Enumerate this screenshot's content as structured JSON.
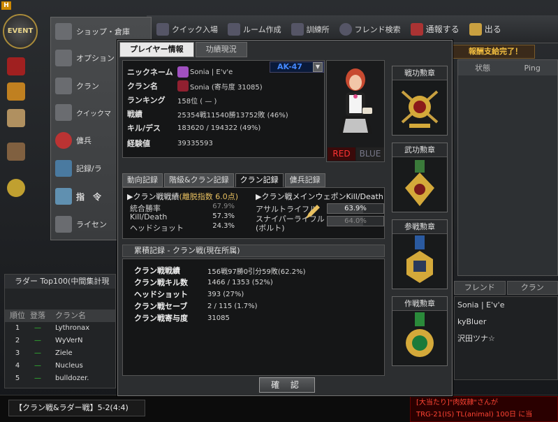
{
  "app": {
    "logo_letter": "H",
    "event_label": "EVENT"
  },
  "toolbar": {
    "items": [
      {
        "label": "クイック入場",
        "icon": "soldiers-icon"
      },
      {
        "label": "ルーム作成",
        "icon": "puzzle-icon"
      },
      {
        "label": "訓練所",
        "icon": "target-icon"
      },
      {
        "label": "フレンド検索",
        "icon": "search-icon"
      },
      {
        "label": "通報する",
        "icon": "alarm-icon"
      },
      {
        "label": "出る",
        "icon": "exit-icon"
      }
    ]
  },
  "left_menu": {
    "items": [
      {
        "label": "ショップ・倉庫"
      },
      {
        "label": "オプション"
      },
      {
        "label": "クラン"
      },
      {
        "label": "クイックマ"
      },
      {
        "label": "傭兵"
      },
      {
        "label": "記録/ラ"
      },
      {
        "label": "指　令"
      },
      {
        "label": "ライセン"
      }
    ]
  },
  "right_panel": {
    "headers": [
      "状態",
      "Ping"
    ],
    "tabs": [
      "フレンド",
      "クラン"
    ],
    "list": [
      "Sonia | E'v'e",
      "kyBluer",
      "沢田ツナ☆"
    ]
  },
  "notice_label": "報酬支給完了！",
  "ladder": {
    "title": "ラダー Top100(中間集計現",
    "headers": [
      "順位",
      "登落",
      "クラン名"
    ],
    "rows": [
      {
        "rank": "1",
        "move": "—",
        "name": "Lythronax"
      },
      {
        "rank": "2",
        "move": "—",
        "name": "WyVerN"
      },
      {
        "rank": "3",
        "move": "—",
        "name": "Ziele"
      },
      {
        "rank": "4",
        "move": "—",
        "name": "Nucleus"
      },
      {
        "rank": "5",
        "move": "—",
        "name": "bulldozer."
      }
    ]
  },
  "bottom": {
    "channel": "【クラン戦&ラダー戦】5-2(4:4)",
    "ticker": [
      "[大当たり]\"肉奴隷\"さんが",
      "TRG-21(IS) TL(animal) 100日 に当"
    ]
  },
  "modal": {
    "tabs": [
      "プレイヤー情報",
      "功績現況"
    ],
    "profile": {
      "nickname_label": "ニックネーム",
      "nickname": "Sonia | E'v'e",
      "clan_label": "クラン名",
      "clan": "Sonia (寄与度 31085)",
      "ranking_label": "ランキング",
      "ranking": "158位 ( — )",
      "record_label": "戦績",
      "record": "25354戦11540勝13752敗 (46%)",
      "kd_label": "キル/デス",
      "kd": "183620 / 194322 (49%)",
      "exp_label": "経験値",
      "exp": "39335593"
    },
    "weapon": "AK-47",
    "teams": [
      "RED",
      "BLUE"
    ],
    "medals": [
      "戦功勲章",
      "武功勲章",
      "参戦勲章",
      "作戦勲章"
    ],
    "sub_tabs": [
      "動向記録",
      "階級&クラン記録",
      "クラン記録",
      "傭兵記録"
    ],
    "clan_battle": {
      "title": "▶クラン戦戦績",
      "dropout": "(離脱指数 6.0点)",
      "rows": [
        {
          "label": "統合勝率",
          "value": "67.9%"
        },
        {
          "label": "Kill/Death",
          "value": "57.3%"
        },
        {
          "label": "ヘッドショット",
          "value": "24.3%"
        }
      ]
    },
    "main_weapon": {
      "title": "▶クラン戦メインウェポンKill/Death",
      "rows": [
        {
          "label": "アサルトライフル",
          "value": "63.9%",
          "level": 0.639
        },
        {
          "label": "スナイパーライフル\n(ボルト)",
          "value": "64.0%",
          "level": 0.64
        }
      ]
    },
    "cumulative_title": "累積記録 - クラン戦(現在所属)",
    "cumulative": [
      {
        "label": "クラン戦戦績",
        "value": "156戦97勝0引分59敗(62.2%)"
      },
      {
        "label": "クラン戦キル数",
        "value": "1466 / 1353 (52%)"
      },
      {
        "label": "ヘッドショット",
        "value": "393 (27%)"
      },
      {
        "label": "クラン戦セーブ",
        "value": "2 / 115 (1.7%)"
      },
      {
        "label": "クラン戦寄与度",
        "value": "31085"
      }
    ],
    "ok_label": "確 認"
  },
  "colors": {
    "accent_gold": "#d4a93a",
    "red_text": "#ff3333",
    "weapon_blue": "#4488ff"
  }
}
